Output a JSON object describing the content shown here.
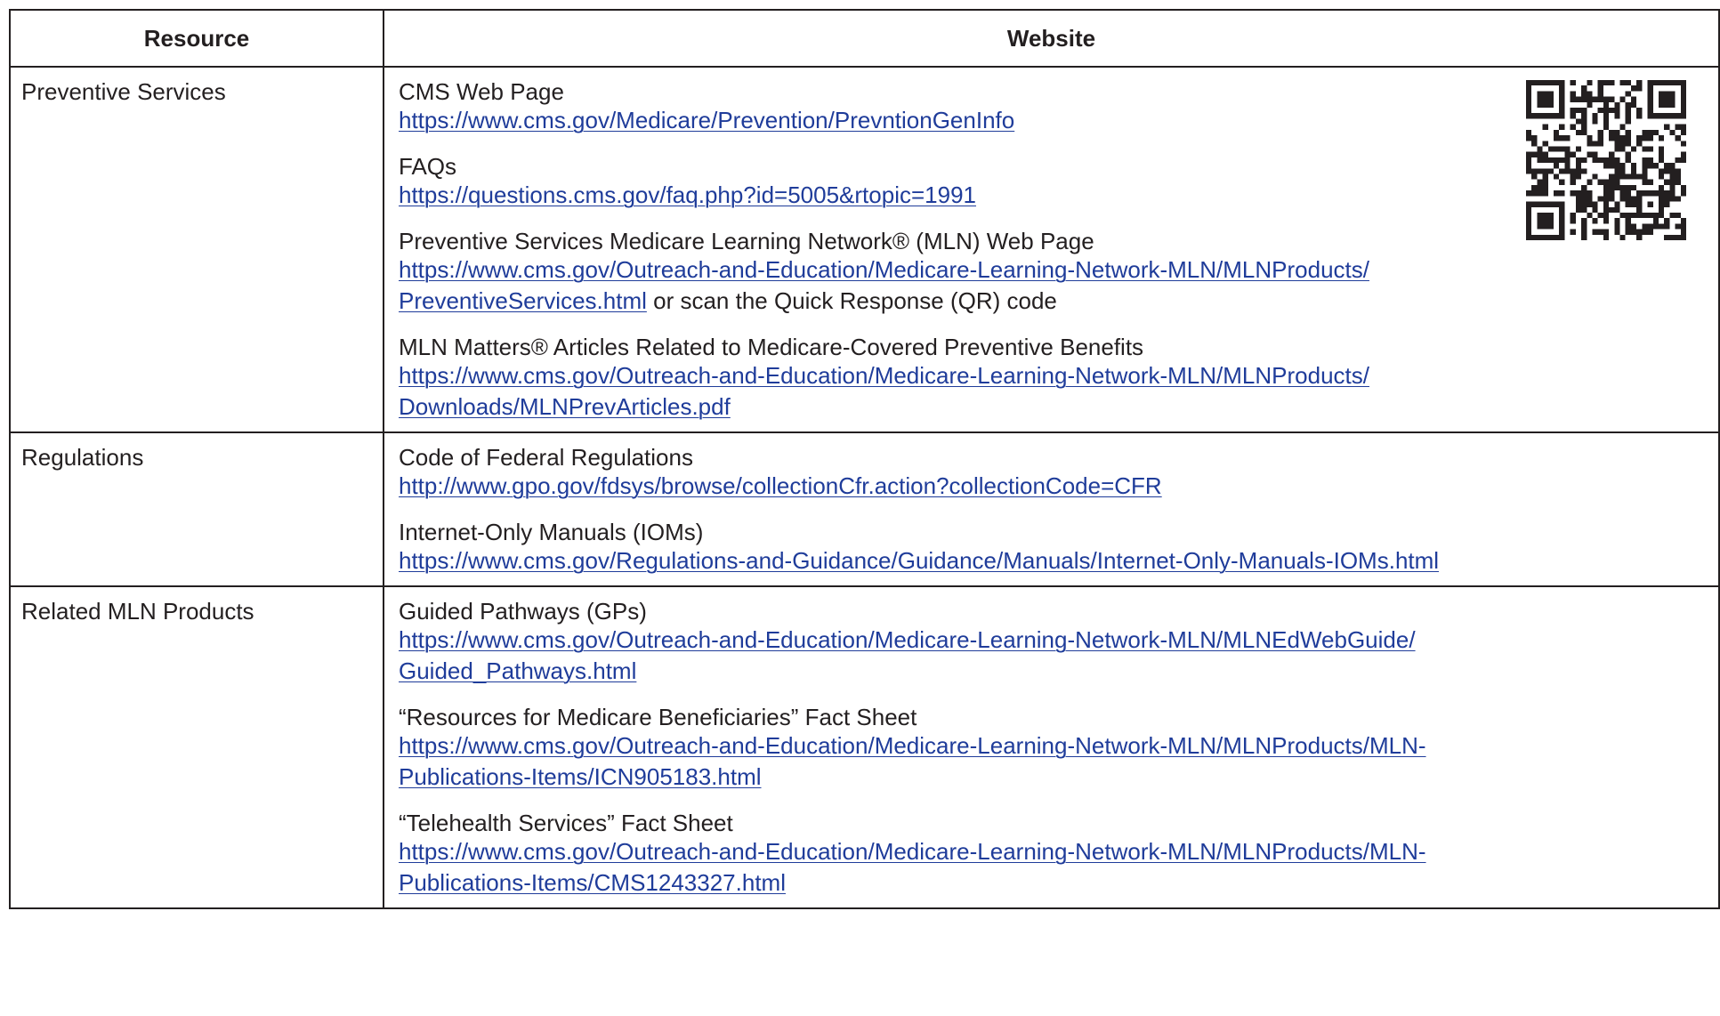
{
  "table": {
    "headers": {
      "resource": "Resource",
      "website": "Website"
    },
    "rows": [
      {
        "resource": "Preventive Services",
        "entries": [
          {
            "title": "CMS Web Page",
            "link_lines": [
              "https://www.cms.gov/Medicare/Prevention/PrevntionGenInfo"
            ],
            "suffix": ""
          },
          {
            "title": "FAQs",
            "link_lines": [
              "https://questions.cms.gov/faq.php?id=5005&rtopic=1991"
            ],
            "suffix": ""
          },
          {
            "title": "Preventive Services Medicare Learning Network® (MLN) Web Page",
            "link_lines": [
              "https://www.cms.gov/Outreach-and-Education/Medicare-Learning-Network-MLN/MLNProducts/",
              "PreventiveServices.html"
            ],
            "suffix": " or scan the Quick Response (QR) code"
          },
          {
            "title": "MLN Matters® Articles Related to Medicare-Covered Preventive Benefits",
            "link_lines": [
              "https://www.cms.gov/Outreach-and-Education/Medicare-Learning-Network-MLN/MLNProducts/",
              "Downloads/MLNPrevArticles.pdf"
            ],
            "suffix": ""
          }
        ]
      },
      {
        "resource": "Regulations",
        "entries": [
          {
            "title": "Code of Federal Regulations",
            "link_lines": [
              "http://www.gpo.gov/fdsys/browse/collectionCfr.action?collectionCode=CFR"
            ],
            "suffix": ""
          },
          {
            "title": "Internet-Only Manuals (IOMs)",
            "link_lines": [
              "https://www.cms.gov/Regulations-and-Guidance/Guidance/Manuals/Internet-Only-Manuals-IOMs.html"
            ],
            "suffix": ""
          }
        ]
      },
      {
        "resource": "Related MLN Products",
        "entries": [
          {
            "title": "Guided Pathways (GPs)",
            "link_lines": [
              "https://www.cms.gov/Outreach-and-Education/Medicare-Learning-Network-MLN/MLNEdWebGuide/",
              "Guided_Pathways.html"
            ],
            "suffix": ""
          },
          {
            "title": "“Resources for Medicare Beneficiaries” Fact Sheet",
            "link_lines": [
              "https://www.cms.gov/Outreach-and-Education/Medicare-Learning-Network-MLN/MLNProducts/MLN-",
              "Publications-Items/ICN905183.html"
            ],
            "suffix": ""
          },
          {
            "title": "“Telehealth Services” Fact Sheet",
            "link_lines": [
              "https://www.cms.gov/Outreach-and-Education/Medicare-Learning-Network-MLN/MLNProducts/MLN-",
              "Publications-Items/CMS1243327.html"
            ],
            "suffix": ""
          }
        ]
      }
    ]
  },
  "qr_code": {
    "icon": "qr-code-icon"
  },
  "colors": {
    "link": "#1f3c9a",
    "text": "#231f20",
    "border": "#231f20"
  }
}
